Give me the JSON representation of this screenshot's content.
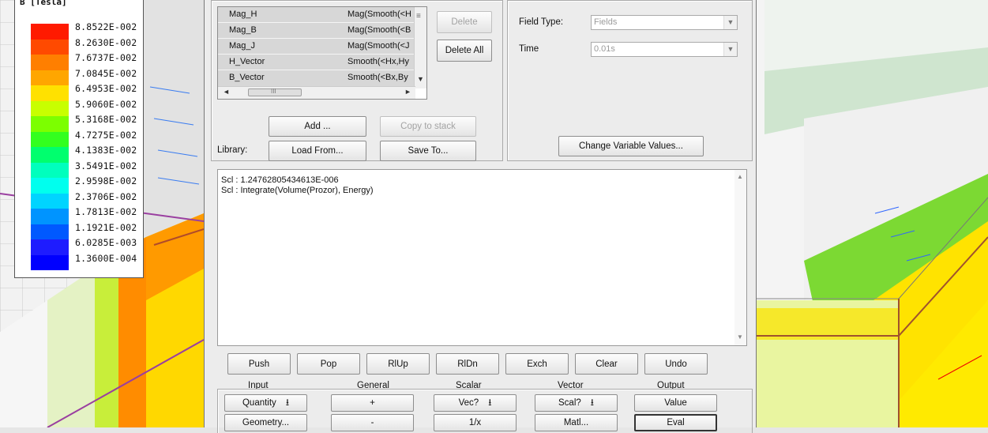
{
  "legend": {
    "title": "B [Tesla]",
    "colors": [
      "#ff1a00",
      "#ff4a00",
      "#ff7f00",
      "#ffa600",
      "#ffe100",
      "#c8ff00",
      "#7cff00",
      "#33ff1f",
      "#00ff6e",
      "#00ffbd",
      "#00ffee",
      "#00d4ff",
      "#0094ff",
      "#0059ff",
      "#1e1cff",
      "#0000ff"
    ],
    "labels": [
      "8.8522E-002",
      "8.2630E-002",
      "7.6737E-002",
      "7.0845E-002",
      "6.4953E-002",
      "5.9060E-002",
      "5.3168E-002",
      "4.7275E-002",
      "4.1383E-002",
      "3.5491E-002",
      "2.9598E-002",
      "2.3706E-002",
      "1.7813E-002",
      "1.1921E-002",
      "6.0285E-003",
      "1.3600E-004"
    ]
  },
  "calculator": {
    "named_expressions": [
      {
        "name": "Mag_H",
        "expr": "Mag(Smooth(<H"
      },
      {
        "name": "Mag_B",
        "expr": "Mag(Smooth(<B"
      },
      {
        "name": "Mag_J",
        "expr": "Mag(Smooth(<J"
      },
      {
        "name": "H_Vector",
        "expr": "Smooth(<Hx,Hy"
      },
      {
        "name": "B_Vector",
        "expr": "Smooth(<Bx,By"
      }
    ],
    "scroll_mark": "III",
    "delete_label": "Delete",
    "delete_all_label": "Delete All",
    "add_label": "Add ...",
    "copy_to_stack_label": "Copy to stack",
    "library_label": "Library:",
    "load_from_label": "Load From...",
    "save_to_label": "Save To...",
    "field_type_label": "Field Type:",
    "field_type_value": "Fields",
    "time_label": "Time",
    "time_value": "0.01s",
    "change_vars_label": "Change Variable Values...",
    "stack_lines": [
      "Scl : 1.24762805434613E-006",
      "Scl : Integrate(Volume(Prozor), Energy)"
    ],
    "stack_buttons": [
      "Push",
      "Pop",
      "RlUp",
      "RlDn",
      "Exch",
      "Clear",
      "Undo"
    ],
    "columns": [
      "Input",
      "General",
      "Scalar",
      "Vector",
      "Output"
    ],
    "row1": [
      "Quantity",
      "+",
      "Vec?",
      "Scal?",
      "Value"
    ],
    "row2": [
      "Geometry...",
      "-",
      "1/x",
      "Matl...",
      "Eval"
    ]
  }
}
